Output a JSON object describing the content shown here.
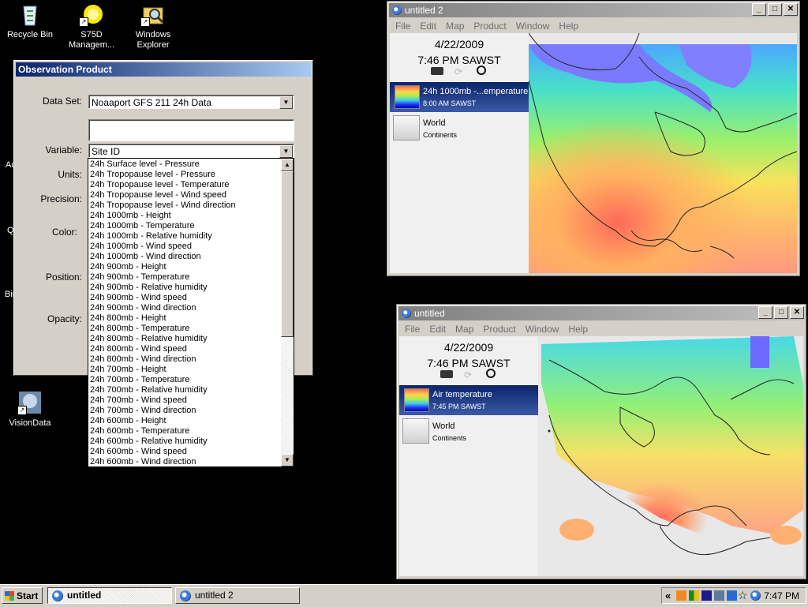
{
  "desktop": {
    "icons": [
      {
        "label": "Recycle Bin"
      },
      {
        "label": "S75D Managem..."
      },
      {
        "label": "Windows Explorer"
      },
      {
        "label": "VisionData"
      }
    ],
    "partial_labels": [
      "Ac",
      "Q",
      "Bin"
    ]
  },
  "window_untitled2": {
    "title": "untitled 2",
    "menu": [
      "File",
      "Edit",
      "Map",
      "Product",
      "Window",
      "Help"
    ],
    "date": "4/22/2009",
    "time": "7:46 PM SAWST",
    "layer_selected": {
      "name": "24h 1000mb -...emperature",
      "time": "8:00 AM SAWST"
    },
    "layer_base": {
      "name": "World",
      "sub": "Continents"
    }
  },
  "window_untitled": {
    "title": "untitled",
    "menu": [
      "File",
      "Edit",
      "Map",
      "Product",
      "Window",
      "Help"
    ],
    "date": "4/22/2009",
    "time": "7:46 PM SAWST",
    "layer_selected": {
      "name": "Air temperature",
      "time": "7:45 PM SAWST"
    },
    "layer_base": {
      "name": "World",
      "sub": "Continents"
    }
  },
  "dialog": {
    "title": "Observation Product",
    "labels": {
      "dataset": "Data Set:",
      "variable": "Variable:",
      "units": "Units:",
      "precision": "Precision:",
      "color": "Color:",
      "position": "Position:",
      "opacity": "Opacity:"
    },
    "dataset_value": "Noaaport GFS 211 24h Data",
    "search_value": "",
    "variable_value": "Site ID",
    "variable_options": [
      "24h Surface level - Pressure",
      "24h Tropopause level - Pressure",
      "24h Tropopause level - Temperature",
      "24h Tropopause level - Wind speed",
      "24h Tropopause level - Wind direction",
      "24h 1000mb - Height",
      "24h 1000mb - Temperature",
      "24h 1000mb - Relative humidity",
      "24h 1000mb - Wind speed",
      "24h 1000mb - Wind direction",
      "24h 900mb - Height",
      "24h 900mb - Temperature",
      "24h 900mb - Relative humidity",
      "24h 900mb - Wind speed",
      "24h 900mb - Wind direction",
      "24h 800mb - Height",
      "24h 800mb - Temperature",
      "24h 800mb - Relative humidity",
      "24h 800mb - Wind speed",
      "24h 800mb - Wind direction",
      "24h 700mb - Height",
      "24h 700mb - Temperature",
      "24h 700mb - Relative humidity",
      "24h 700mb - Wind speed",
      "24h 700mb - Wind direction",
      "24h 600mb - Height",
      "24h 600mb - Temperature",
      "24h 600mb - Relative humidity",
      "24h 600mb - Wind speed",
      "24h 600mb - Wind direction"
    ]
  },
  "taskbar": {
    "start_label": "Start",
    "tasks": [
      {
        "label": "untitled"
      },
      {
        "label": "untitled 2"
      }
    ],
    "tray_chevron": "«",
    "clock": "7:47 PM"
  },
  "colors": {
    "titlebar_active": "#0a246a",
    "selection": "#0a246a",
    "desktop": "#000000",
    "face": "#d4d0c8"
  }
}
